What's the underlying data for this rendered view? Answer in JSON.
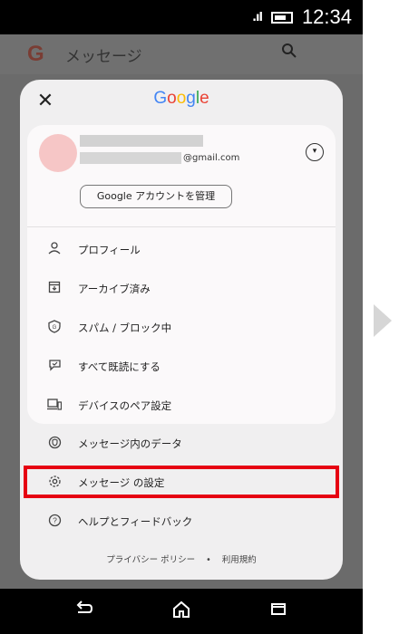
{
  "status": {
    "signal": ".ıl",
    "time": "12:34"
  },
  "app": {
    "logo": "G",
    "title": "メッセージ"
  },
  "sheet": {
    "close": "✕",
    "logo_letters": [
      "G",
      "o",
      "o",
      "g",
      "l",
      "e"
    ],
    "account": {
      "email_domain": "@gmail.com",
      "expand": "▾",
      "manage_button": "Google アカウントを管理"
    },
    "menu": [
      {
        "label": "プロフィール",
        "icon": "person-icon",
        "glyph": "♙"
      },
      {
        "label": "アーカイブ済み",
        "icon": "archive-icon",
        "glyph": "⊡"
      },
      {
        "label": "スパム / ブロック中",
        "icon": "shield-icon",
        "glyph": "⊚"
      },
      {
        "label": "すべて既読にする",
        "icon": "chat-check-icon",
        "glyph": "⌕"
      },
      {
        "label": "デバイスのペア設定",
        "icon": "devices-icon",
        "glyph": "⊏"
      }
    ],
    "extra": [
      {
        "label": "メッセージ内のデータ",
        "icon": "data-shield-icon",
        "glyph": "⊛"
      },
      {
        "label": "メッセージ の設定",
        "icon": "gear-icon",
        "glyph": "⚙"
      },
      {
        "label": "ヘルプとフィードバック",
        "icon": "help-icon",
        "glyph": "?"
      }
    ],
    "footer": {
      "privacy": "プライバシー ポリシー",
      "dot": "•",
      "terms": "利用規約"
    }
  },
  "nav": {
    "back": "↩",
    "home": "⌂",
    "recents": "▭"
  },
  "colors": {
    "highlight": "#e60012",
    "avatar": "#f6c6c6"
  }
}
